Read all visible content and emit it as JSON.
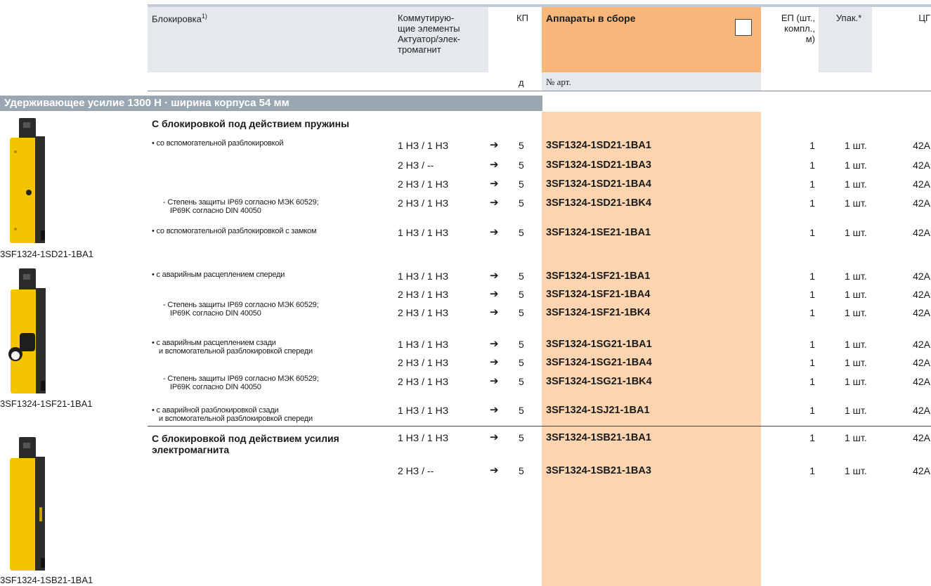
{
  "header": {
    "col_lock": "Блокировка",
    "col_lock_sup": "1)",
    "col_switch_lines": [
      "Коммутирую-",
      "щие элементы",
      "Актуатор/элек-",
      "тромагнит"
    ],
    "col_kp": "КП",
    "col_kp_sub": "д",
    "col_assembled": "Аппараты в сборе",
    "col_art_no": "№ арт.",
    "col_ep_lines": [
      "ЕП (шт.,",
      "компл.,",
      "м)"
    ],
    "col_pack": "Упак.*",
    "col_cg": "ЦГ"
  },
  "section_title": "Удерживающее усилие 1300 Н · ширина корпуса 54 мм",
  "groups": {
    "spring": "С блокировкой под действием пружины",
    "magnet_lines": [
      "С блокировкой под действием усилия",
      "электромагнита"
    ]
  },
  "descriptions": {
    "d1": "• со вспомогательной разблокировкой",
    "d2_lines": [
      "- Степень защиты IP69 согласно МЭК 60529;",
      "IP69K согласно DIN 40050"
    ],
    "d3": "• со вспомогательной разблокировкой с замком",
    "d4": "• с аварийным расцеплением спереди",
    "d5_lines": [
      "- Степень защиты IP69 согласно МЭК 60529;",
      "IP69K согласно DIN 40050"
    ],
    "d6_lines": [
      "• с аварийным расцеплением сзади",
      "и вспомогательной разблокировкой спереди"
    ],
    "d7_lines": [
      "- Степень защиты IP69 согласно МЭК 60529;",
      "IP69K согласно DIN 40050"
    ],
    "d8_lines": [
      "• с аварийной разблокировкой сзади",
      "и вспомогательной разблокировкой спереди"
    ]
  },
  "arrow_symbol": "➔",
  "rows": [
    {
      "sw": "1 НЗ / 1 НЗ",
      "kp": "5",
      "art": "3SF1324-1SD21-1BA1",
      "ep": "1",
      "pack": "1 шт.",
      "cg": "42A"
    },
    {
      "sw": "2 НЗ / --",
      "kp": "5",
      "art": "3SF1324-1SD21-1BA3",
      "ep": "1",
      "pack": "1 шт.",
      "cg": "42A"
    },
    {
      "sw": "2 НЗ / 1 НЗ",
      "kp": "5",
      "art": "3SF1324-1SD21-1BA4",
      "ep": "1",
      "pack": "1 шт.",
      "cg": "42A"
    },
    {
      "sw": "2 НЗ / 1 НЗ",
      "kp": "5",
      "art": "3SF1324-1SD21-1BK4",
      "ep": "1",
      "pack": "1 шт.",
      "cg": "42A"
    },
    {
      "sw": "1 НЗ / 1 НЗ",
      "kp": "5",
      "art": "3SF1324-1SE21-1BA1",
      "ep": "1",
      "pack": "1 шт.",
      "cg": "42A"
    },
    {
      "sw": "1 НЗ / 1 НЗ",
      "kp": "5",
      "art": "3SF1324-1SF21-1BA1",
      "ep": "1",
      "pack": "1 шт.",
      "cg": "42A"
    },
    {
      "sw": "2 НЗ / 1 НЗ",
      "kp": "5",
      "art": "3SF1324-1SF21-1BA4",
      "ep": "1",
      "pack": "1 шт.",
      "cg": "42A"
    },
    {
      "sw": "2 НЗ / 1 НЗ",
      "kp": "5",
      "art": "3SF1324-1SF21-1BK4",
      "ep": "1",
      "pack": "1 шт.",
      "cg": "42A"
    },
    {
      "sw": "1 НЗ / 1 НЗ",
      "kp": "5",
      "art": "3SF1324-1SG21-1BA1",
      "ep": "1",
      "pack": "1 шт.",
      "cg": "42A"
    },
    {
      "sw": "2 НЗ / 1 НЗ",
      "kp": "5",
      "art": "3SF1324-1SG21-1BA4",
      "ep": "1",
      "pack": "1 шт.",
      "cg": "42A"
    },
    {
      "sw": "2 НЗ / 1 НЗ",
      "kp": "5",
      "art": "3SF1324-1SG21-1BK4",
      "ep": "1",
      "pack": "1 шт.",
      "cg": "42A"
    },
    {
      "sw": "1 НЗ / 1 НЗ",
      "kp": "5",
      "art": "3SF1324-1SJ21-1BA1",
      "ep": "1",
      "pack": "1 шт.",
      "cg": "42A"
    },
    {
      "sw": "1 НЗ / 1 НЗ",
      "kp": "5",
      "art": "3SF1324-1SB21-1BA1",
      "ep": "1",
      "pack": "1 шт.",
      "cg": "42A"
    },
    {
      "sw": "2 НЗ / --",
      "kp": "5",
      "art": "3SF1324-1SB21-1BA3",
      "ep": "1",
      "pack": "1 шт.",
      "cg": "42A"
    }
  ],
  "captions": {
    "img1": "3SF1324-1SD21-1BA1",
    "img2": "3SF1324-1SF21-1BA1",
    "img3": "3SF1324-1SB21-1BA1"
  },
  "colors": {
    "header_bg": "#e4e9ed",
    "assembled_header": "#f8b77a",
    "assembled_column": "#fcd5b0",
    "section_bar": "#9aa6b0",
    "switch_yellow": "#f2c500"
  }
}
